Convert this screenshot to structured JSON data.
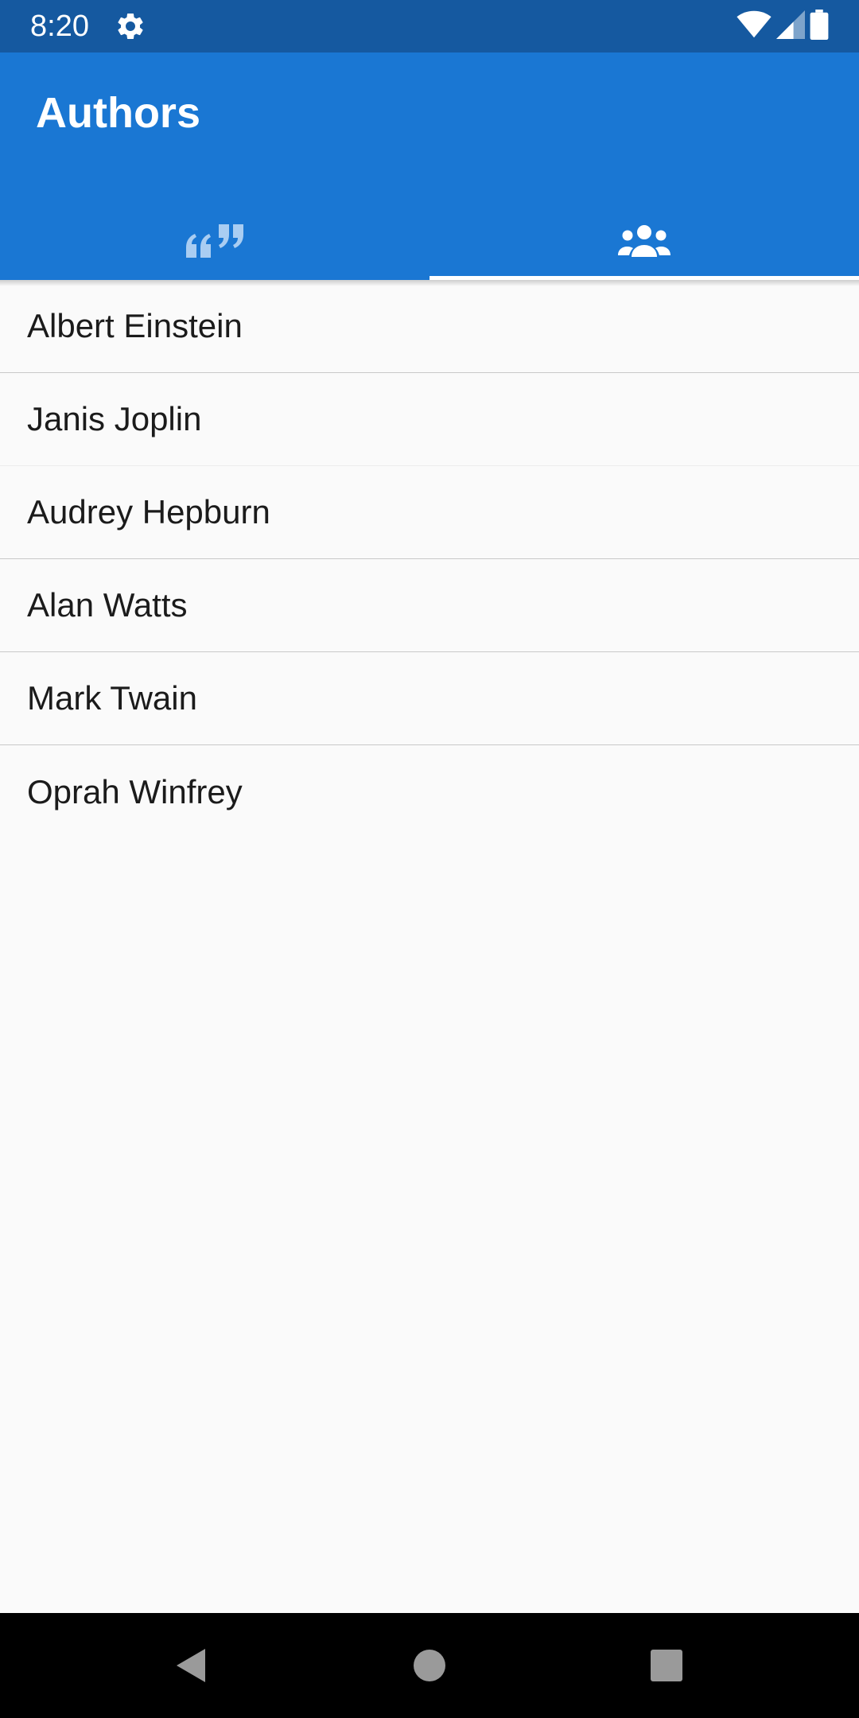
{
  "status_bar": {
    "time": "8:20",
    "icons": [
      "gear-icon",
      "wifi-icon",
      "cell-signal-icon",
      "battery-icon"
    ]
  },
  "app_bar": {
    "title": "Authors",
    "background": "#1a77d3"
  },
  "tabs": [
    {
      "icon": "quote-icon",
      "selected": false
    },
    {
      "icon": "people-icon",
      "selected": true
    }
  ],
  "authors": [
    "Albert Einstein",
    "Janis Joplin",
    "Audrey Hepburn",
    "Alan Watts",
    "Mark Twain",
    "Oprah Winfrey"
  ],
  "nav_bar": {
    "buttons": [
      "back-icon",
      "home-icon",
      "recents-icon"
    ]
  }
}
